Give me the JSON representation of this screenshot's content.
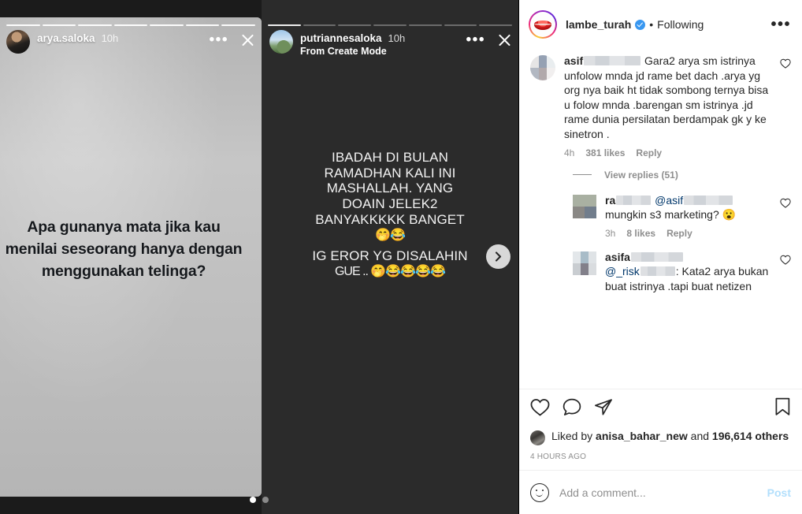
{
  "stories": {
    "previous": {
      "username": "arya.saloka",
      "time": "10h",
      "quote_lines": [
        "Apa gunanya mata jika kau",
        "menilai seseorang hanya dengan",
        "menggunakan telinga?"
      ],
      "progress_segments": 7,
      "progress_filled": 7,
      "more_icon": "•••",
      "close_icon": "close-x"
    },
    "current": {
      "username": "putriannesaloka",
      "time": "10h",
      "subtitle": "From Create Mode",
      "text_lines": [
        "IBADAH DI BULAN",
        "RAMADHAN KALI INI",
        "MASHALLAH. YANG",
        "DOAIN JELEK2",
        "BANYAKKKKK BANGET",
        "🤭😂",
        "IG EROR YG DISALAHIN",
        "GUE .. 🤭😂😂😂😂"
      ],
      "progress_segments": 7,
      "progress_filled": 1,
      "more_icon": "•••",
      "close_icon": "close-x"
    },
    "next_button_icon": "chevron-right-icon",
    "pagination_dots": 2,
    "pagination_active": 0
  },
  "post": {
    "header": {
      "username": "lambe_turah",
      "verified": true,
      "separator": "•",
      "follow_state": "Following",
      "more_icon": "•••",
      "avatar_icon": "lips-logo-avatar"
    },
    "comments": [
      {
        "username": "asif",
        "username_redacted_width": 72,
        "text": "Gara2 arya sm istrinya unfolow mnda jd rame bet dach .arya yg org nya baik ht tidak sombong ternya bisa u folow mnda .barengan sm istrinya .jd rame dunia persilatan berdampak gk y ke sinetron .",
        "time": "4h",
        "likes": "381 likes",
        "reply_label": "Reply",
        "like_icon": "heart-outline-icon"
      },
      {
        "username": "ra",
        "username_redacted_width": 44,
        "mention": "@asif",
        "mention_redacted_width": 62,
        "text": "mungkin s3 marketing? 😮",
        "time": "3h",
        "likes": "8 likes",
        "reply_label": "Reply",
        "like_icon": "heart-outline-icon"
      },
      {
        "username": "asifa",
        "username_redacted_width": 66,
        "mention": "@_risk",
        "mention_redacted_width": 44,
        "text": ": Kata2 arya bukan buat istrinya .tapi buat netizen",
        "time": "",
        "likes": "",
        "reply_label": "",
        "like_icon": "heart-outline-icon"
      }
    ],
    "view_replies": "View replies (51)",
    "actions": {
      "like_icon": "heart-outline-icon",
      "comment_icon": "comment-bubble-icon",
      "share_icon": "share-paperplane-icon",
      "save_icon": "bookmark-outline-icon"
    },
    "liked_by": {
      "prefix": "Liked by",
      "username": "anisa_bahar_new",
      "middle": "and",
      "count": "196,614 others"
    },
    "timestamp": "4 HOURS AGO",
    "add_comment": {
      "emoji_icon": "smiley-face-icon",
      "placeholder": "Add a comment...",
      "post_label": "Post"
    }
  },
  "colors": {
    "accent_blue": "#3897f0",
    "post_button": "#b2dffc",
    "text_primary": "#262626",
    "text_secondary": "#8e8e8e",
    "mention": "#00376b"
  }
}
